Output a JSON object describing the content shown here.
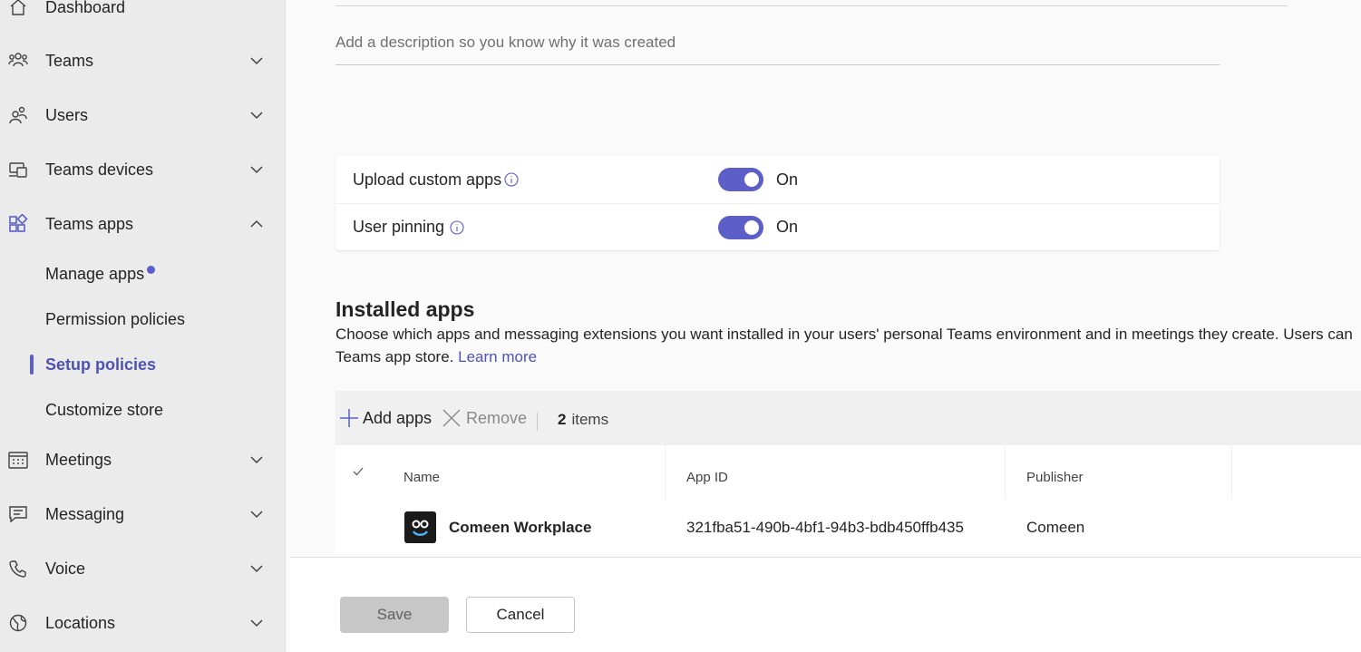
{
  "sidebar": {
    "items": [
      {
        "label": "Dashboard",
        "icon": "home-icon"
      },
      {
        "label": "Teams",
        "icon": "teams-icon"
      },
      {
        "label": "Users",
        "icon": "users-icon"
      },
      {
        "label": "Teams devices",
        "icon": "devices-icon"
      },
      {
        "label": "Teams apps",
        "icon": "apps-icon",
        "expanded": true
      },
      {
        "label": "Meetings",
        "icon": "calendar-icon"
      },
      {
        "label": "Messaging",
        "icon": "chat-icon"
      },
      {
        "label": "Voice",
        "icon": "phone-icon"
      },
      {
        "label": "Locations",
        "icon": "globe-icon"
      }
    ],
    "sub_items": [
      {
        "label": "Manage apps",
        "has_dot": true
      },
      {
        "label": "Permission policies"
      },
      {
        "label": "Setup policies",
        "active": true
      },
      {
        "label": "Customize store"
      }
    ]
  },
  "form": {
    "description_placeholder": "Add a description so you know why it was created",
    "settings": [
      {
        "label": "Upload custom apps",
        "state": "On",
        "enabled": true
      },
      {
        "label": "User pinning",
        "state": "On",
        "enabled": true
      }
    ]
  },
  "installed_apps": {
    "title": "Installed apps",
    "description_line1": "Choose which apps and messaging extensions you want installed in your users' personal Teams environment and in meetings they create. Users can",
    "description_line2": "Teams app store.",
    "learn_more": "Learn more",
    "toolbar": {
      "add_label": "Add apps",
      "remove_label": "Remove",
      "count": "2",
      "count_suffix": "items"
    },
    "columns": [
      "Name",
      "App ID",
      "Publisher"
    ],
    "rows": [
      {
        "name": "Comeen Workplace",
        "app_id": "321fba51-490b-4bf1-94b3-bdb450ffb435",
        "publisher": "Comeen"
      }
    ]
  },
  "footer": {
    "save_label": "Save",
    "cancel_label": "Cancel"
  },
  "colors": {
    "accent": "#5b5fc7",
    "link": "#4f52b2",
    "sidebar_bg": "#ebebeb"
  }
}
